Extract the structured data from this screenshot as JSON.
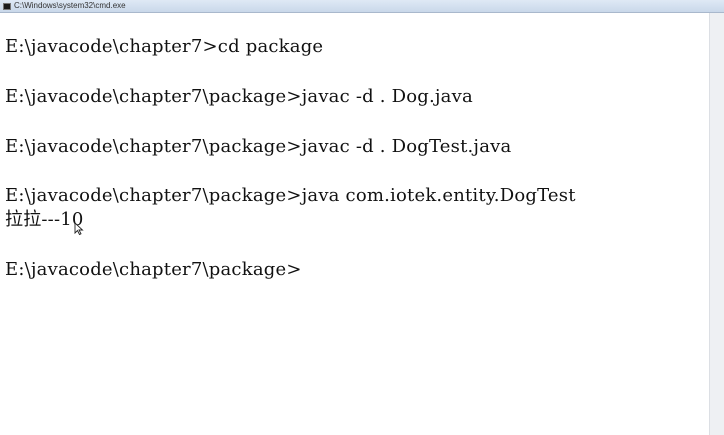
{
  "window": {
    "title": "C:\\Windows\\system32\\cmd.exe"
  },
  "console": {
    "lines": [
      "E:\\javacode\\chapter7>cd package",
      "E:\\javacode\\chapter7\\package>javac -d . Dog.java",
      "E:\\javacode\\chapter7\\package>javac -d . DogTest.java",
      "E:\\javacode\\chapter7\\package>java com.iotek.entity.DogTest",
      "拉拉---10",
      "E:\\javacode\\chapter7\\package>"
    ]
  },
  "colors": {
    "background": "#ffffff",
    "text": "#111111"
  },
  "icons": {
    "title": "cmd-icon",
    "pointer": "mouse-cursor-icon"
  }
}
